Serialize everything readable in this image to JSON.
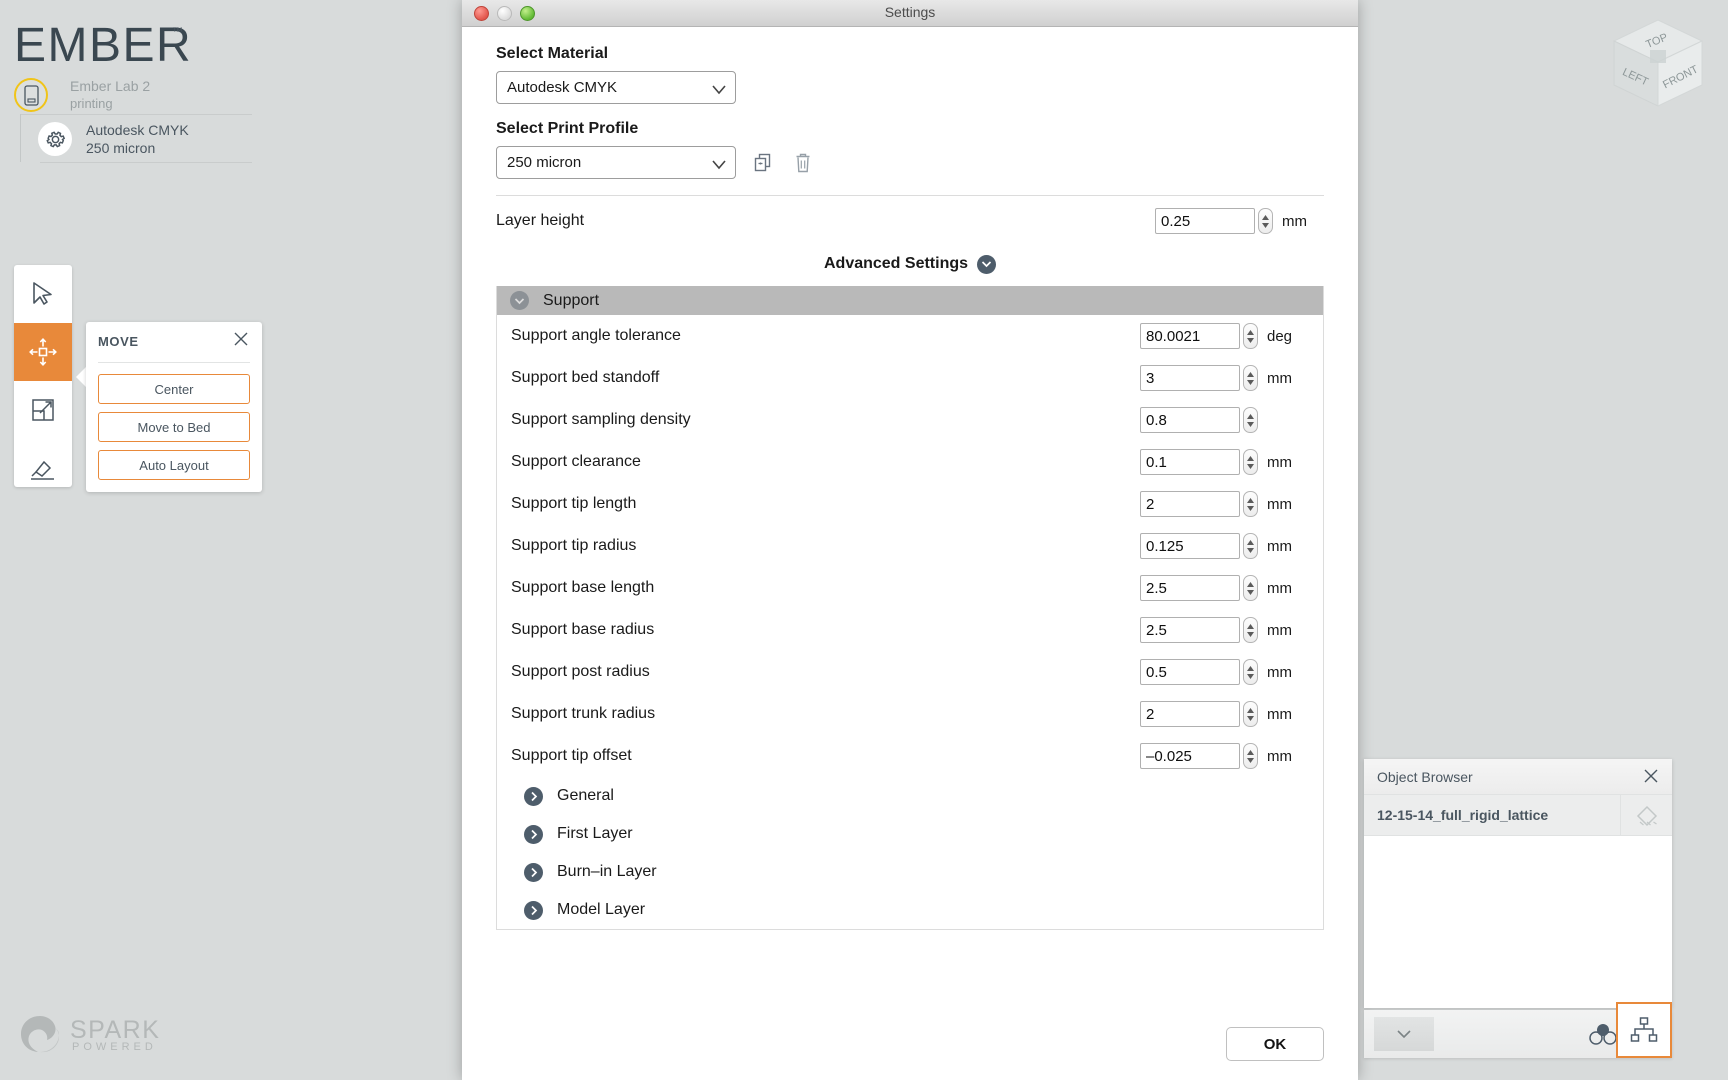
{
  "brand": {
    "name": "EMBER",
    "tm": "™",
    "spark_name": "SPARK",
    "spark_sub": "POWERED"
  },
  "printer": {
    "name": "Ember Lab 2",
    "status": "printing",
    "material": "Autodesk CMYK",
    "resolution": "250 micron"
  },
  "move_panel": {
    "title": "MOVE",
    "buttons": [
      "Center",
      "Move to Bed",
      "Auto Layout"
    ]
  },
  "viewcube": {
    "top": "TOP",
    "left": "LEFT",
    "front": "FRONT"
  },
  "settings": {
    "window_title": "Settings",
    "material_label": "Select Material",
    "material_value": "Autodesk CMYK",
    "profile_label": "Select Print Profile",
    "profile_value": "250 micron",
    "layer_height": {
      "label": "Layer height",
      "value": "0.25",
      "unit": "mm"
    },
    "advanced_label": "Advanced Settings",
    "support_group": "Support",
    "support_rows": [
      {
        "label": "Support angle tolerance",
        "value": "80.0021",
        "unit": "deg"
      },
      {
        "label": "Support bed standoff",
        "value": "3",
        "unit": "mm"
      },
      {
        "label": "Support sampling density",
        "value": "0.8",
        "unit": ""
      },
      {
        "label": "Support clearance",
        "value": "0.1",
        "unit": "mm"
      },
      {
        "label": "Support tip length",
        "value": "2",
        "unit": "mm"
      },
      {
        "label": "Support tip radius",
        "value": "0.125",
        "unit": "mm"
      },
      {
        "label": "Support base length",
        "value": "2.5",
        "unit": "mm"
      },
      {
        "label": "Support base radius",
        "value": "2.5",
        "unit": "mm"
      },
      {
        "label": "Support post radius",
        "value": "0.5",
        "unit": "mm"
      },
      {
        "label": "Support trunk radius",
        "value": "2",
        "unit": "mm"
      },
      {
        "label": "Support tip offset",
        "value": "–0.025",
        "unit": "mm"
      }
    ],
    "collapsed_groups": [
      "General",
      "First Layer",
      "Burn–in Layer",
      "Model Layer"
    ],
    "ok_label": "OK"
  },
  "object_browser": {
    "title": "Object Browser",
    "items": [
      "12-15-14_full_rigid_lattice"
    ]
  },
  "colors": {
    "accent": "#e8893a",
    "badge_yellow": "#f0c419",
    "text_dark": "#4a5660",
    "canvas": "#d8dbdb",
    "group_header": "#b9b9b9"
  }
}
